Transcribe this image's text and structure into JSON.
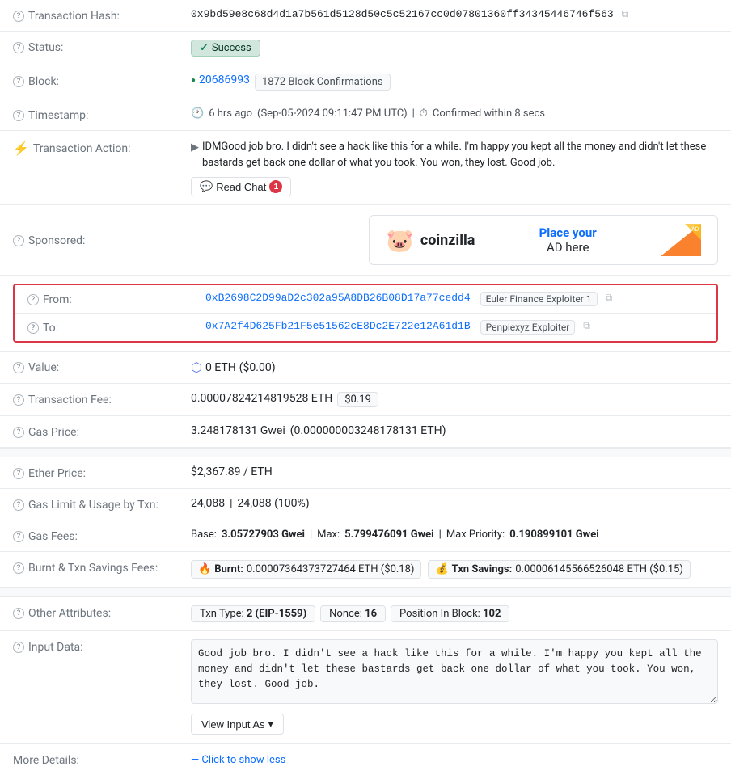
{
  "transaction": {
    "hash": {
      "label": "Transaction Hash:",
      "value": "0x9bd59e8c68d4d1a7b561d5128d50c5c52167cc0d07801360ff34345446746f563",
      "copy_title": "Copy transaction hash"
    },
    "status": {
      "label": "Status:",
      "value": "Success"
    },
    "block": {
      "label": "Block:",
      "number": "20686993",
      "confirmations": "1872 Block Confirmations"
    },
    "timestamp": {
      "label": "Timestamp:",
      "ago": "6 hrs ago",
      "datetime": "(Sep-05-2024 09:11:47 PM UTC)",
      "separator": "|",
      "confirmed": "Confirmed within 8 secs"
    },
    "action": {
      "label": "Transaction Action:",
      "text": "IDMGood job bro. I didn't see a hack like this for a while. I'm happy you kept all the money and didn't let these bastards get back one dollar of what you took. You won, they lost. Good job.",
      "read_chat_label": "Read Chat",
      "chat_badge": "1"
    },
    "sponsored": {
      "label": "Sponsored:",
      "logo_emoji": "🐷",
      "logo_name": "coinzilla",
      "ad_text_line1": "Place your",
      "ad_text_line2": "AD here"
    },
    "from": {
      "label": "From:",
      "address": "0xB2698C2D99aD2c302a95A8DB26B08D17a77cedd4",
      "tag": "Euler Finance Exploiter 1",
      "copy_title": "Copy from address"
    },
    "to": {
      "label": "To:",
      "address": "0x7A2f4D625Fb21F5e51562cE8Dc2E722e12A61d1B",
      "tag": "Penpiexyz Exploiter",
      "copy_title": "Copy to address"
    },
    "value": {
      "label": "Value:",
      "eth": "0 ETH",
      "usd": "($0.00)"
    },
    "fee": {
      "label": "Transaction Fee:",
      "eth_value": "0.00007824214819528 ETH",
      "usd_value": "$0.19"
    },
    "gas_price": {
      "label": "Gas Price:",
      "gwei": "3.248178131 Gwei",
      "eth": "(0.000000003248178131 ETH)"
    },
    "ether_price": {
      "label": "Ether Price:",
      "value": "$2,367.89 / ETH"
    },
    "gas_limit": {
      "label": "Gas Limit & Usage by Txn:",
      "limit": "24,088",
      "separator": "|",
      "usage": "24,088 (100%)"
    },
    "gas_fees": {
      "label": "Gas Fees:",
      "base_label": "Base:",
      "base_value": "3.05727903 Gwei",
      "max_label": "Max:",
      "max_value": "5.799476091 Gwei",
      "max_priority_label": "Max Priority:",
      "max_priority_value": "0.190899101 Gwei"
    },
    "burnt_savings": {
      "label": "Burnt & Txn Savings Fees:",
      "burnt_emoji": "🔥",
      "burnt_label": "Burnt:",
      "burnt_value": "0.00007364373727464 ETH ($0.18)",
      "savings_emoji": "💰",
      "savings_label": "Txn Savings:",
      "savings_value": "0.00006145566526048 ETH ($0.15)"
    },
    "other_attributes": {
      "label": "Other Attributes:",
      "txn_type_label": "Txn Type:",
      "txn_type_value": "2 (EIP-1559)",
      "nonce_label": "Nonce:",
      "nonce_value": "16",
      "position_label": "Position In Block:",
      "position_value": "102"
    },
    "input_data": {
      "label": "Input Data:",
      "text": "Good job bro. I didn't see a hack like this for a while. I'm happy you kept all the money and didn't let these bastards get back one dollar of what you took. You won, they lost. Good job.",
      "view_input_label": "View Input As",
      "dropdown_arrow": "▾"
    },
    "more_details": {
      "label": "More Details:",
      "show_less_label": "— Click to show less"
    }
  }
}
